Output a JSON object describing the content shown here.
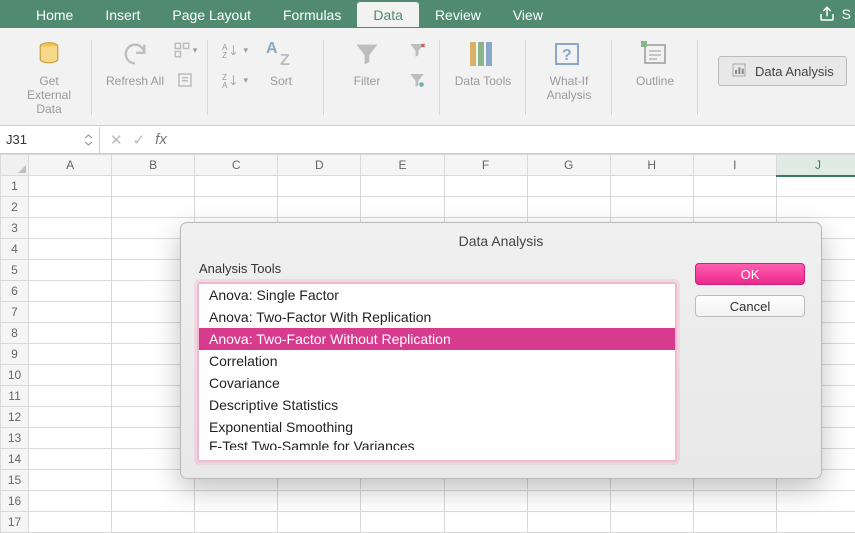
{
  "tabs": {
    "items": [
      "Home",
      "Insert",
      "Page Layout",
      "Formulas",
      "Data",
      "Review",
      "View"
    ],
    "active_index": 4,
    "share_label": "S"
  },
  "ribbon": {
    "get_external_data": "Get External\nData",
    "refresh_all": "Refresh\nAll",
    "sort": "Sort",
    "filter": "Filter",
    "data_tools": "Data\nTools",
    "what_if": "What-If\nAnalysis",
    "outline": "Outline",
    "data_analysis": "Data Analysis"
  },
  "formula_bar": {
    "name_box": "J31",
    "formula_value": ""
  },
  "grid": {
    "columns": [
      "A",
      "B",
      "C",
      "D",
      "E",
      "F",
      "G",
      "H",
      "I",
      "J"
    ],
    "active_column_index": 9,
    "rows": [
      1,
      2,
      3,
      4,
      5,
      6,
      7,
      8,
      9,
      10,
      11,
      12,
      13,
      14,
      15,
      16,
      17
    ]
  },
  "dialog": {
    "title": "Data Analysis",
    "tools_label": "Analysis Tools",
    "tools": [
      "Anova: Single Factor",
      "Anova: Two-Factor With Replication",
      "Anova: Two-Factor Without Replication",
      "Correlation",
      "Covariance",
      "Descriptive Statistics",
      "Exponential Smoothing",
      "F-Test Two-Sample for Variances"
    ],
    "selected_index": 2,
    "ok_label": "OK",
    "cancel_label": "Cancel"
  }
}
